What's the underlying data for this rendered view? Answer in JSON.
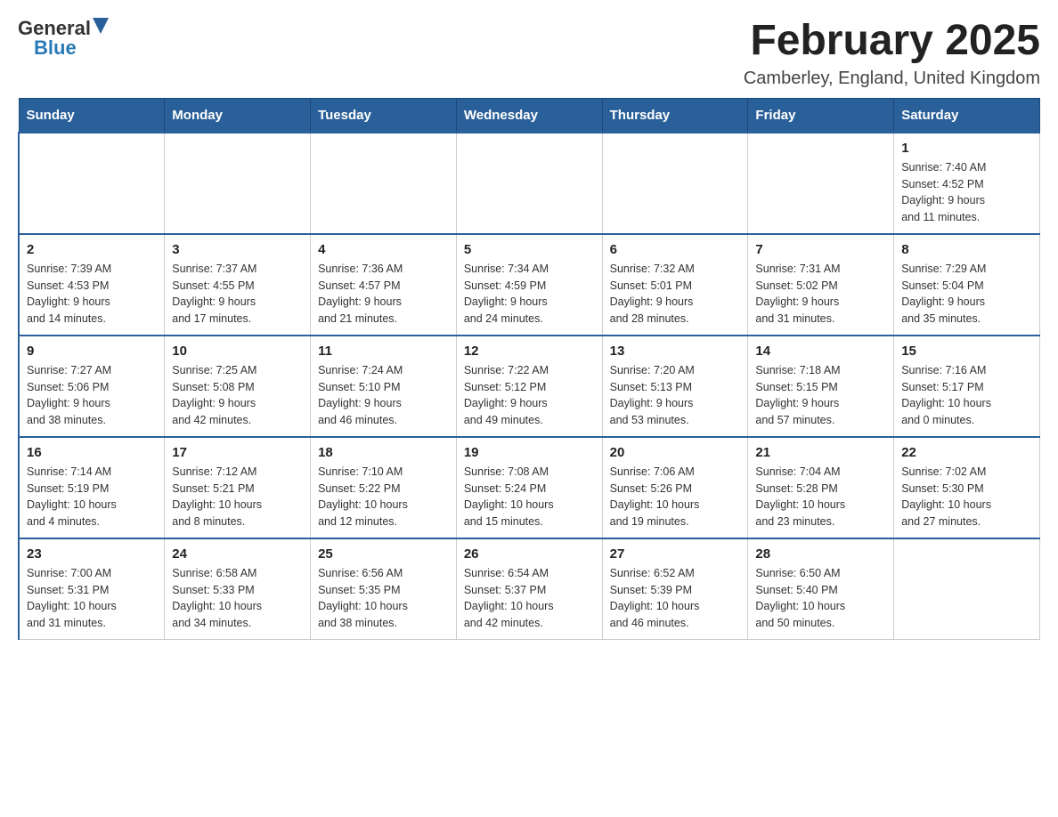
{
  "logo": {
    "general": "General",
    "blue": "Blue"
  },
  "title": "February 2025",
  "subtitle": "Camberley, England, United Kingdom",
  "days_of_week": [
    "Sunday",
    "Monday",
    "Tuesday",
    "Wednesday",
    "Thursday",
    "Friday",
    "Saturday"
  ],
  "weeks": [
    [
      {
        "day": "",
        "info": ""
      },
      {
        "day": "",
        "info": ""
      },
      {
        "day": "",
        "info": ""
      },
      {
        "day": "",
        "info": ""
      },
      {
        "day": "",
        "info": ""
      },
      {
        "day": "",
        "info": ""
      },
      {
        "day": "1",
        "info": "Sunrise: 7:40 AM\nSunset: 4:52 PM\nDaylight: 9 hours\nand 11 minutes."
      }
    ],
    [
      {
        "day": "2",
        "info": "Sunrise: 7:39 AM\nSunset: 4:53 PM\nDaylight: 9 hours\nand 14 minutes."
      },
      {
        "day": "3",
        "info": "Sunrise: 7:37 AM\nSunset: 4:55 PM\nDaylight: 9 hours\nand 17 minutes."
      },
      {
        "day": "4",
        "info": "Sunrise: 7:36 AM\nSunset: 4:57 PM\nDaylight: 9 hours\nand 21 minutes."
      },
      {
        "day": "5",
        "info": "Sunrise: 7:34 AM\nSunset: 4:59 PM\nDaylight: 9 hours\nand 24 minutes."
      },
      {
        "day": "6",
        "info": "Sunrise: 7:32 AM\nSunset: 5:01 PM\nDaylight: 9 hours\nand 28 minutes."
      },
      {
        "day": "7",
        "info": "Sunrise: 7:31 AM\nSunset: 5:02 PM\nDaylight: 9 hours\nand 31 minutes."
      },
      {
        "day": "8",
        "info": "Sunrise: 7:29 AM\nSunset: 5:04 PM\nDaylight: 9 hours\nand 35 minutes."
      }
    ],
    [
      {
        "day": "9",
        "info": "Sunrise: 7:27 AM\nSunset: 5:06 PM\nDaylight: 9 hours\nand 38 minutes."
      },
      {
        "day": "10",
        "info": "Sunrise: 7:25 AM\nSunset: 5:08 PM\nDaylight: 9 hours\nand 42 minutes."
      },
      {
        "day": "11",
        "info": "Sunrise: 7:24 AM\nSunset: 5:10 PM\nDaylight: 9 hours\nand 46 minutes."
      },
      {
        "day": "12",
        "info": "Sunrise: 7:22 AM\nSunset: 5:12 PM\nDaylight: 9 hours\nand 49 minutes."
      },
      {
        "day": "13",
        "info": "Sunrise: 7:20 AM\nSunset: 5:13 PM\nDaylight: 9 hours\nand 53 minutes."
      },
      {
        "day": "14",
        "info": "Sunrise: 7:18 AM\nSunset: 5:15 PM\nDaylight: 9 hours\nand 57 minutes."
      },
      {
        "day": "15",
        "info": "Sunrise: 7:16 AM\nSunset: 5:17 PM\nDaylight: 10 hours\nand 0 minutes."
      }
    ],
    [
      {
        "day": "16",
        "info": "Sunrise: 7:14 AM\nSunset: 5:19 PM\nDaylight: 10 hours\nand 4 minutes."
      },
      {
        "day": "17",
        "info": "Sunrise: 7:12 AM\nSunset: 5:21 PM\nDaylight: 10 hours\nand 8 minutes."
      },
      {
        "day": "18",
        "info": "Sunrise: 7:10 AM\nSunset: 5:22 PM\nDaylight: 10 hours\nand 12 minutes."
      },
      {
        "day": "19",
        "info": "Sunrise: 7:08 AM\nSunset: 5:24 PM\nDaylight: 10 hours\nand 15 minutes."
      },
      {
        "day": "20",
        "info": "Sunrise: 7:06 AM\nSunset: 5:26 PM\nDaylight: 10 hours\nand 19 minutes."
      },
      {
        "day": "21",
        "info": "Sunrise: 7:04 AM\nSunset: 5:28 PM\nDaylight: 10 hours\nand 23 minutes."
      },
      {
        "day": "22",
        "info": "Sunrise: 7:02 AM\nSunset: 5:30 PM\nDaylight: 10 hours\nand 27 minutes."
      }
    ],
    [
      {
        "day": "23",
        "info": "Sunrise: 7:00 AM\nSunset: 5:31 PM\nDaylight: 10 hours\nand 31 minutes."
      },
      {
        "day": "24",
        "info": "Sunrise: 6:58 AM\nSunset: 5:33 PM\nDaylight: 10 hours\nand 34 minutes."
      },
      {
        "day": "25",
        "info": "Sunrise: 6:56 AM\nSunset: 5:35 PM\nDaylight: 10 hours\nand 38 minutes."
      },
      {
        "day": "26",
        "info": "Sunrise: 6:54 AM\nSunset: 5:37 PM\nDaylight: 10 hours\nand 42 minutes."
      },
      {
        "day": "27",
        "info": "Sunrise: 6:52 AM\nSunset: 5:39 PM\nDaylight: 10 hours\nand 46 minutes."
      },
      {
        "day": "28",
        "info": "Sunrise: 6:50 AM\nSunset: 5:40 PM\nDaylight: 10 hours\nand 50 minutes."
      },
      {
        "day": "",
        "info": ""
      }
    ]
  ]
}
